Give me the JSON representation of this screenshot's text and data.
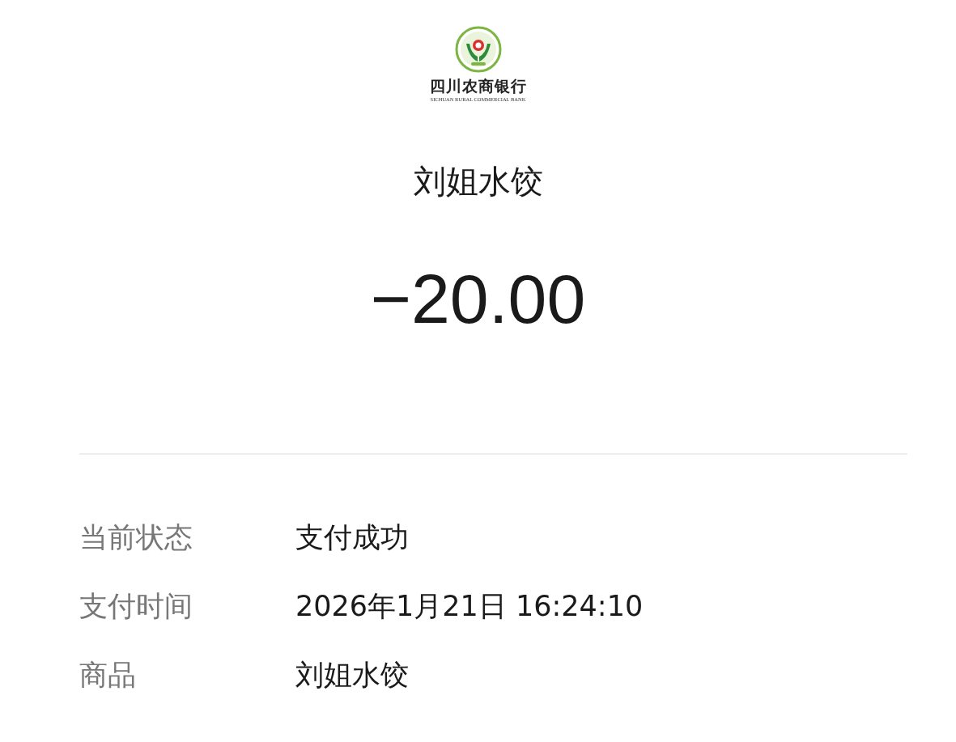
{
  "bank": {
    "name": "四川农商银行",
    "name_en": "SICHUAN RURAL COMMERCIAL BANK"
  },
  "merchant": "刘姐水饺",
  "amount": "−20.00",
  "details": [
    {
      "label": "当前状态",
      "value": "支付成功"
    },
    {
      "label": "支付时间",
      "value": "2026年1月21日 16:24:10"
    },
    {
      "label": "商品",
      "value": "刘姐水饺"
    }
  ]
}
